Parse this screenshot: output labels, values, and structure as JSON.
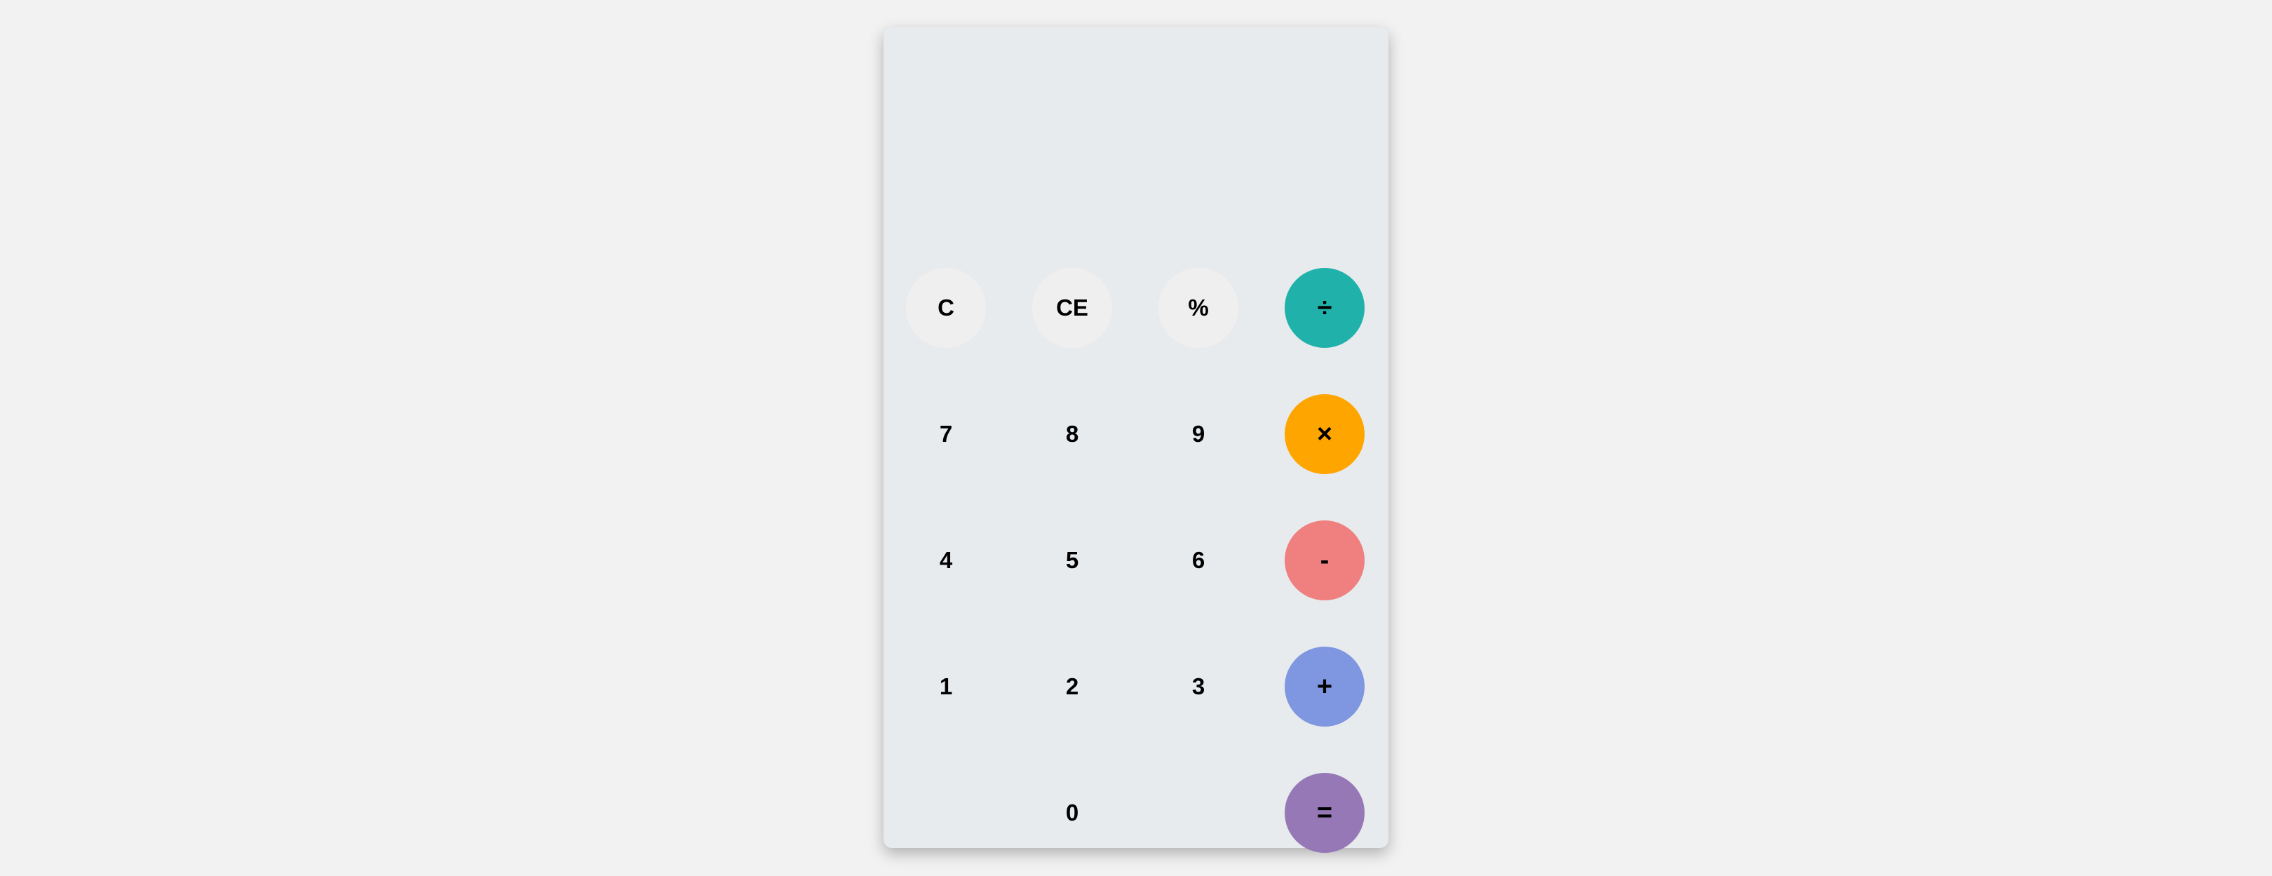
{
  "display": {
    "value": ""
  },
  "keys": {
    "clear": "C",
    "clear_entry": "CE",
    "percent": "%",
    "divide": "÷",
    "seven": "7",
    "eight": "8",
    "nine": "9",
    "multiply": "×",
    "four": "4",
    "five": "5",
    "six": "6",
    "subtract": "-",
    "one": "1",
    "two": "2",
    "three": "3",
    "add": "+",
    "zero": "0",
    "equals": "="
  },
  "colors": {
    "page_background": "#f2f2f2",
    "calculator_background": "#e8ebee",
    "function_key": "#efefef",
    "divide": "#20b2aa",
    "multiply": "#ffa500",
    "subtract": "#f08080",
    "add": "#7f96e0",
    "equals": "#9678b6"
  }
}
